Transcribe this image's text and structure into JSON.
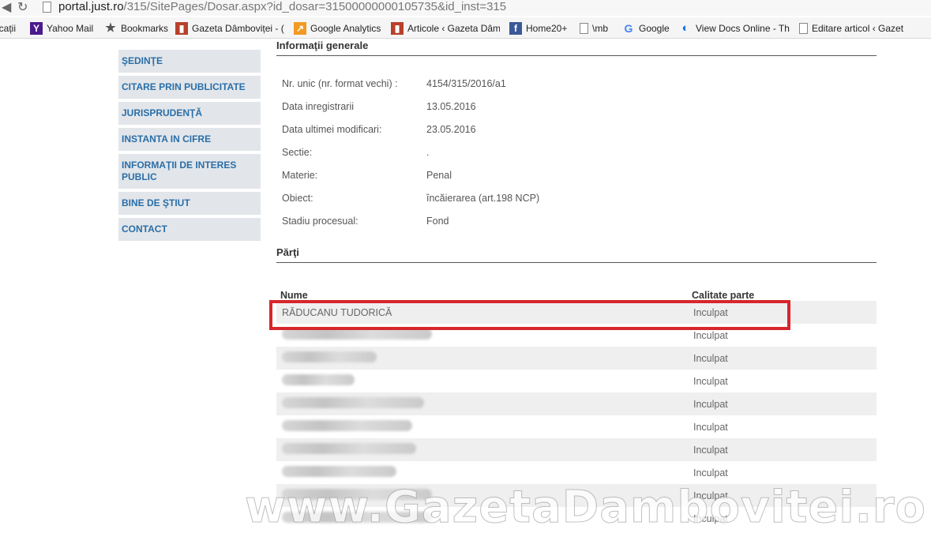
{
  "browser": {
    "url_host": "portal.just.ro",
    "url_path": "/315/SitePages/Dosar.aspx?id_dosar=31500000000105735&id_inst=315",
    "bookmarks": [
      {
        "label": "icații",
        "icon": "none"
      },
      {
        "label": "Yahoo Mail",
        "icon": "yahoo-icon"
      },
      {
        "label": "Bookmarks",
        "icon": "star-icon"
      },
      {
        "label": "Gazeta Dâmboviței - (",
        "icon": "gazeta-icon"
      },
      {
        "label": "Google Analytics",
        "icon": "analytics-icon"
      },
      {
        "label": "Articole ‹ Gazeta Dâm",
        "icon": "gazeta-icon"
      },
      {
        "label": "Home20+",
        "icon": "facebook-icon"
      },
      {
        "label": "\\mb",
        "icon": "page-icon"
      },
      {
        "label": "Google",
        "icon": "google-icon"
      },
      {
        "label": "View Docs Online - Th",
        "icon": "viewdocs-icon"
      },
      {
        "label": "Editare articol ‹ Gazet",
        "icon": "page-icon"
      }
    ]
  },
  "sidebar": {
    "items": [
      {
        "label": "ŞEDINŢE"
      },
      {
        "label": "CITARE PRIN PUBLICITATE"
      },
      {
        "label": "JURISPRUDENŢĂ"
      },
      {
        "label": "INSTANTA IN CIFRE"
      },
      {
        "label": "INFORMAŢII DE INTERES PUBLIC"
      },
      {
        "label": "BINE DE ŞTIUT"
      },
      {
        "label": "CONTACT"
      }
    ]
  },
  "general": {
    "title": "Informaţii generale",
    "rows": [
      {
        "label": "Nr. unic (nr. format vechi) :",
        "value": "4154/315/2016/a1"
      },
      {
        "label": "Data inregistrarii",
        "value": "13.05.2016"
      },
      {
        "label": "Data ultimei modificari:",
        "value": "23.05.2016"
      },
      {
        "label": "Sectie:",
        "value": "."
      },
      {
        "label": "Materie:",
        "value": "Penal"
      },
      {
        "label": "Obiect:",
        "value": "încăierarea (art.198 NCP)"
      },
      {
        "label": "Stadiu procesual:",
        "value": "Fond"
      }
    ]
  },
  "parti": {
    "title": "Părţi",
    "col_name": "Nume",
    "col_role": "Calitate parte",
    "rows": [
      {
        "name": "RĂDUCANU TUDORICĂ",
        "role": "Inculpat"
      },
      {
        "name": "",
        "role": "Inculpat"
      },
      {
        "name": "",
        "role": "Inculpat"
      },
      {
        "name": "",
        "role": "Inculpat"
      },
      {
        "name": "",
        "role": "Inculpat"
      },
      {
        "name": "",
        "role": "Inculpat"
      },
      {
        "name": "",
        "role": "Inculpat"
      },
      {
        "name": "",
        "role": "Inculpat"
      },
      {
        "name": "",
        "role": "Inculpat"
      },
      {
        "name": "",
        "role": "Inculpat"
      }
    ]
  },
  "watermark": "www.GazetaDambovitei.ro"
}
